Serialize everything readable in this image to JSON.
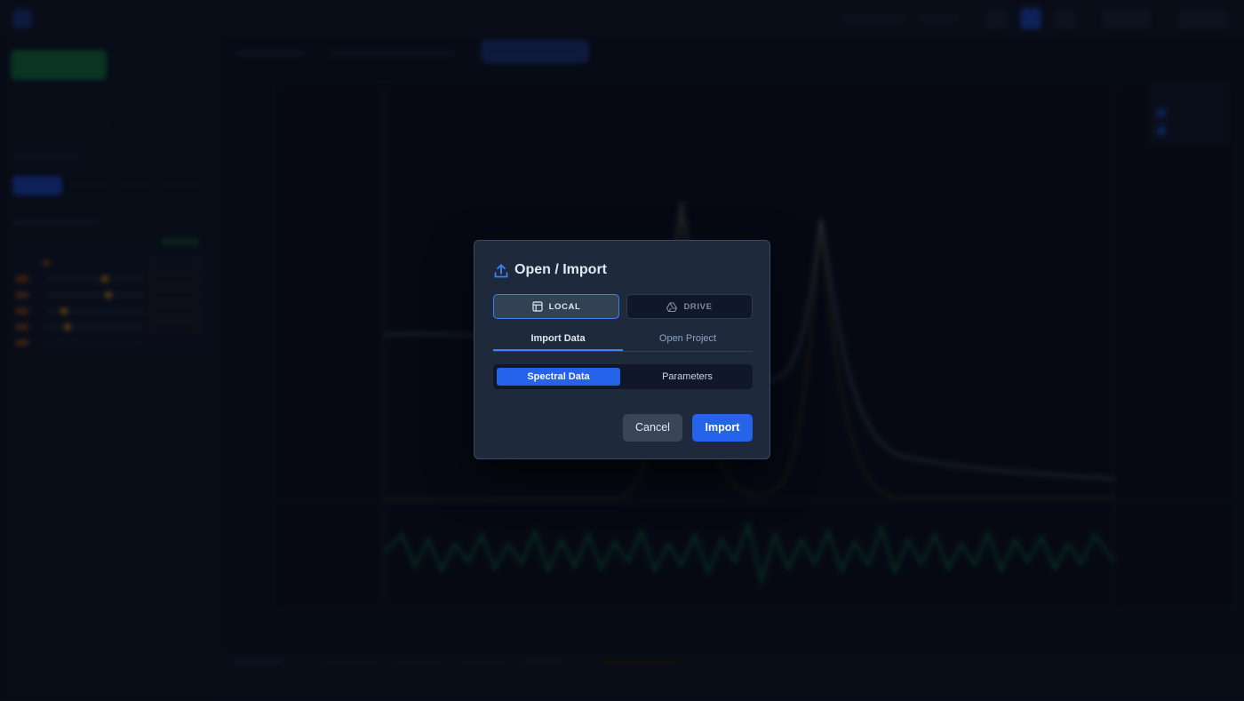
{
  "modal": {
    "title": "Open / Import",
    "source_buttons": [
      {
        "label": "LOCAL",
        "icon": "file-icon",
        "active": true
      },
      {
        "label": "DRIVE",
        "icon": "drive-icon",
        "active": false
      }
    ],
    "tabs": [
      {
        "label": "Import Data",
        "active": true
      },
      {
        "label": "Open Project",
        "active": false
      }
    ],
    "data_types": [
      {
        "label": "Spectral Data",
        "active": true
      },
      {
        "label": "Parameters",
        "active": false
      }
    ],
    "cancel_label": "Cancel",
    "import_label": "Import"
  },
  "colors": {
    "accent": "#2563eb",
    "modal_bg": "#1e293b",
    "page_bg": "#0a0f1a",
    "peak_orange": "#f59e0b",
    "residual_green": "#22c55e"
  }
}
